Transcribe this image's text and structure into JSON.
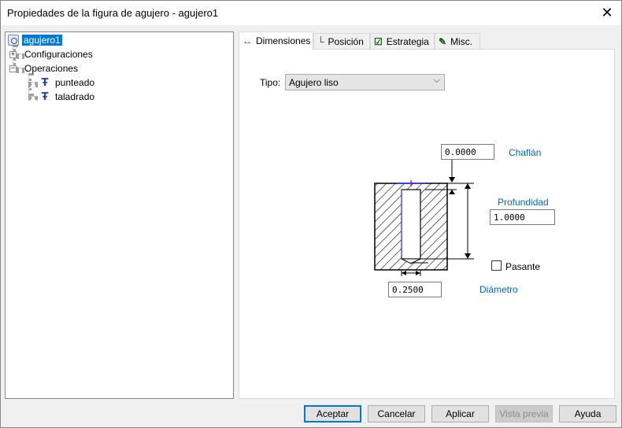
{
  "window": {
    "title": "Propiedades de la figura de agujero - agujero1",
    "close_glyph": "✕"
  },
  "tree": {
    "root": "agujero1",
    "items": [
      {
        "label": "Configuraciones",
        "expander": "+"
      },
      {
        "label": "Operaciones",
        "expander": "−"
      }
    ],
    "operations": [
      "punteado",
      "taladrado"
    ]
  },
  "tabs": [
    {
      "label": "Dimensiones",
      "icon": "dimension-icon"
    },
    {
      "label": "Posición",
      "icon": "position-icon"
    },
    {
      "label": "Estrategia",
      "icon": "strategy-icon"
    },
    {
      "label": "Misc.",
      "icon": "misc-icon"
    }
  ],
  "form": {
    "tipo_label": "Tipo:",
    "tipo_value": "Agujero liso",
    "chaflan_value": "0.0000",
    "chaflan_label": "Chaflán",
    "profundidad_label": "Profundidad",
    "profundidad_value": "1.0000",
    "pasante_label": "Pasante",
    "pasante_checked": false,
    "diametro_value": "0.2500",
    "diametro_label": "Diámetro"
  },
  "buttons": {
    "accept": "Aceptar",
    "cancel": "Cancelar",
    "apply": "Aplicar",
    "preview": "Vista previa",
    "help": "Ayuda"
  }
}
